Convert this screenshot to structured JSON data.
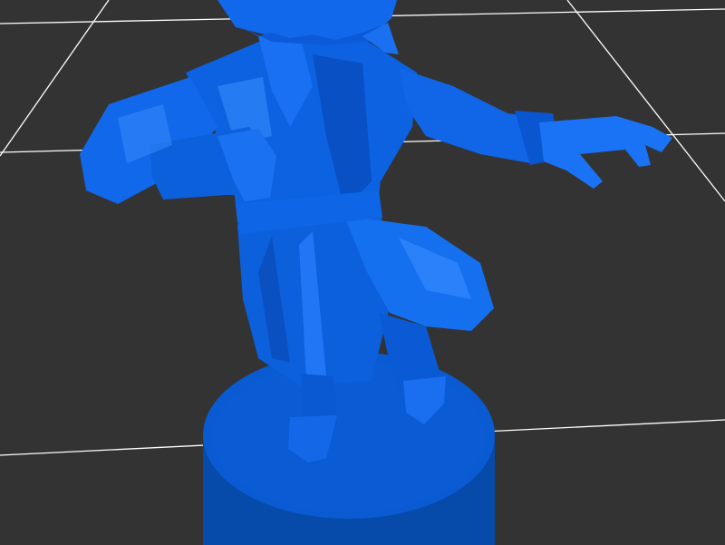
{
  "scene": {
    "background_color": "#333333",
    "grid_color": "#ffffff",
    "model_color": "#0a64e6",
    "model_highlight": "#2a86ff",
    "model_shadow": "#0448b4",
    "base_color": "#0a5ad2",
    "base_rim_color": "#064aaa"
  }
}
